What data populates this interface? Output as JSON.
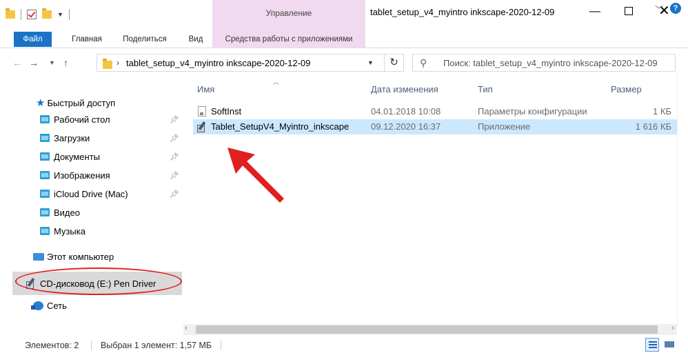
{
  "window": {
    "title": "tablet_setup_v4_myintro inkscape-2020-12-09",
    "contextual_tab_group": "Управление"
  },
  "ribbon": {
    "tabs": [
      {
        "label": "Файл"
      },
      {
        "label": "Главная"
      },
      {
        "label": "Поделиться"
      },
      {
        "label": "Вид"
      },
      {
        "label": "Средства работы с приложениями"
      }
    ],
    "help": "?"
  },
  "address": {
    "path": "tablet_setup_v4_myintro inkscape-2020-12-09",
    "search_placeholder": "Поиск: tablet_setup_v4_myintro inkscape-2020-12-09"
  },
  "navpane": {
    "quick_access": "Быстрый доступ",
    "items": [
      {
        "label": "Рабочий стол",
        "pinned": true
      },
      {
        "label": "Загрузки",
        "pinned": true
      },
      {
        "label": "Документы",
        "pinned": true
      },
      {
        "label": "Изображения",
        "pinned": true
      },
      {
        "label": "iCloud Drive (Mac)",
        "pinned": true
      },
      {
        "label": "Видео",
        "pinned": false
      },
      {
        "label": "Музыка",
        "pinned": false
      }
    ],
    "this_pc": "Этот компьютер",
    "cd_drive": "CD-дисковод (E:) Pen Driver",
    "network": "Сеть"
  },
  "files": {
    "columns": {
      "name": "Имя",
      "date": "Дата изменения",
      "type": "Тип",
      "size": "Размер"
    },
    "rows": [
      {
        "name": "SoftInst",
        "date": "04.01.2018 10:08",
        "type": "Параметры конфигурации",
        "size": "1 КБ",
        "icon": "config-file-icon",
        "selected": false
      },
      {
        "name": "Tablet_SetupV4_Myintro_inkscape",
        "date": "09.12.2020 16:37",
        "type": "Приложение",
        "size": "1 616 КБ",
        "icon": "setup-app-icon",
        "selected": true
      }
    ]
  },
  "status": {
    "count": "Элементов: 2",
    "selection": "Выбран 1 элемент: 1,57 МБ"
  },
  "colors": {
    "accent": "#1a73c7",
    "contextual_tab": "#f1d9ef",
    "selection": "#cce8ff",
    "annotation_red": "#e01f1f"
  }
}
